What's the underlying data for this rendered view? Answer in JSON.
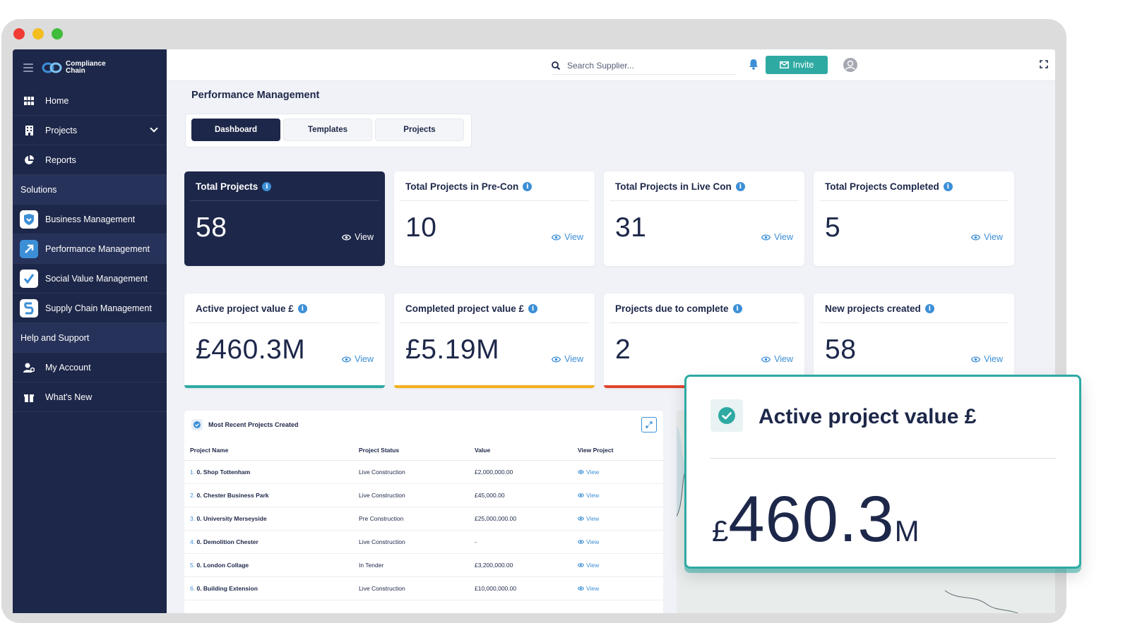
{
  "app": {
    "logo_line1": "Compliance",
    "logo_line2": "Chain"
  },
  "sidebar": {
    "items": [
      {
        "label": "Home",
        "icon": "grid-icon"
      },
      {
        "label": "Projects",
        "icon": "building-icon"
      },
      {
        "label": "Reports",
        "icon": "pie-chart-icon"
      }
    ],
    "solutions_header": "Solutions",
    "solutions": [
      {
        "label": "Business Management",
        "icon": "shield-icon",
        "color": "#3c8fd6"
      },
      {
        "label": "Performance Management",
        "icon": "arrow-up-right-icon",
        "color": "#3c8fd6"
      },
      {
        "label": "Social Value Management",
        "icon": "heart-check-icon",
        "color": "#3c8fd6"
      },
      {
        "label": "Supply Chain Management",
        "icon": "chain-icon",
        "color": "#3c8fd6"
      }
    ],
    "help_header": "Help and Support",
    "help": [
      {
        "label": "My Account",
        "icon": "user-gear-icon"
      },
      {
        "label": "What's New",
        "icon": "gift-icon"
      }
    ]
  },
  "topbar": {
    "search_placeholder": "Search Supplier...",
    "invite_label": "Invite"
  },
  "page": {
    "title": "Performance Management",
    "tabs": [
      "Dashboard",
      "Templates",
      "Projects"
    ],
    "active_tab": "Dashboard"
  },
  "cards": [
    {
      "title": "Total Projects",
      "value": "58",
      "view": "View"
    },
    {
      "title": "Total Projects in Pre-Con",
      "value": "10",
      "view": "View"
    },
    {
      "title": "Total Projects in Live Con",
      "value": "31",
      "view": "View"
    },
    {
      "title": "Total Projects Completed",
      "value": "5",
      "view": "View"
    },
    {
      "title": "Active project value £",
      "value": "£460.3M",
      "view": "View",
      "bar_color": "#2eaaa3"
    },
    {
      "title": "Completed project value £",
      "value": "£5.19M",
      "view": "View",
      "bar_color": "#f2b01e"
    },
    {
      "title": "Projects due to complete",
      "value": "2",
      "view": "View",
      "bar_color": "#e0452f"
    },
    {
      "title": "New projects created",
      "value": "58",
      "view": "View"
    }
  ],
  "recent": {
    "title": "Most Recent Projects Created",
    "columns": [
      "Project Name",
      "Project Status",
      "Value",
      "View Project"
    ],
    "rows": [
      {
        "num": "1.",
        "name": "0. Shop Tottenham",
        "status": "Live Construction",
        "value": "£2,000,000.00",
        "view": "View"
      },
      {
        "num": "2.",
        "name": "0. Chester Business Park",
        "status": "Live Construction",
        "value": "£45,000.00",
        "view": "View"
      },
      {
        "num": "3.",
        "name": "0. University Merseyside",
        "status": "Pre Construction",
        "value": "£25,000,000.00",
        "view": "View"
      },
      {
        "num": "4.",
        "name": "0. Demolition Chester",
        "status": "Live Construction",
        "value": "-",
        "view": "View"
      },
      {
        "num": "5.",
        "name": "0. London Collage",
        "status": "In Tender",
        "value": "£3,200,000.00",
        "view": "View"
      },
      {
        "num": "6.",
        "name": "0. Building Extension",
        "status": "Live Construction",
        "value": "£10,000,000.00",
        "view": "View"
      }
    ]
  },
  "popout": {
    "title": "Active project value £",
    "currency": "£",
    "number": "460.3",
    "suffix": "M"
  },
  "colors": {
    "navy": "#1d2749",
    "teal": "#2eaaa3",
    "blue": "#3c8fd6"
  }
}
